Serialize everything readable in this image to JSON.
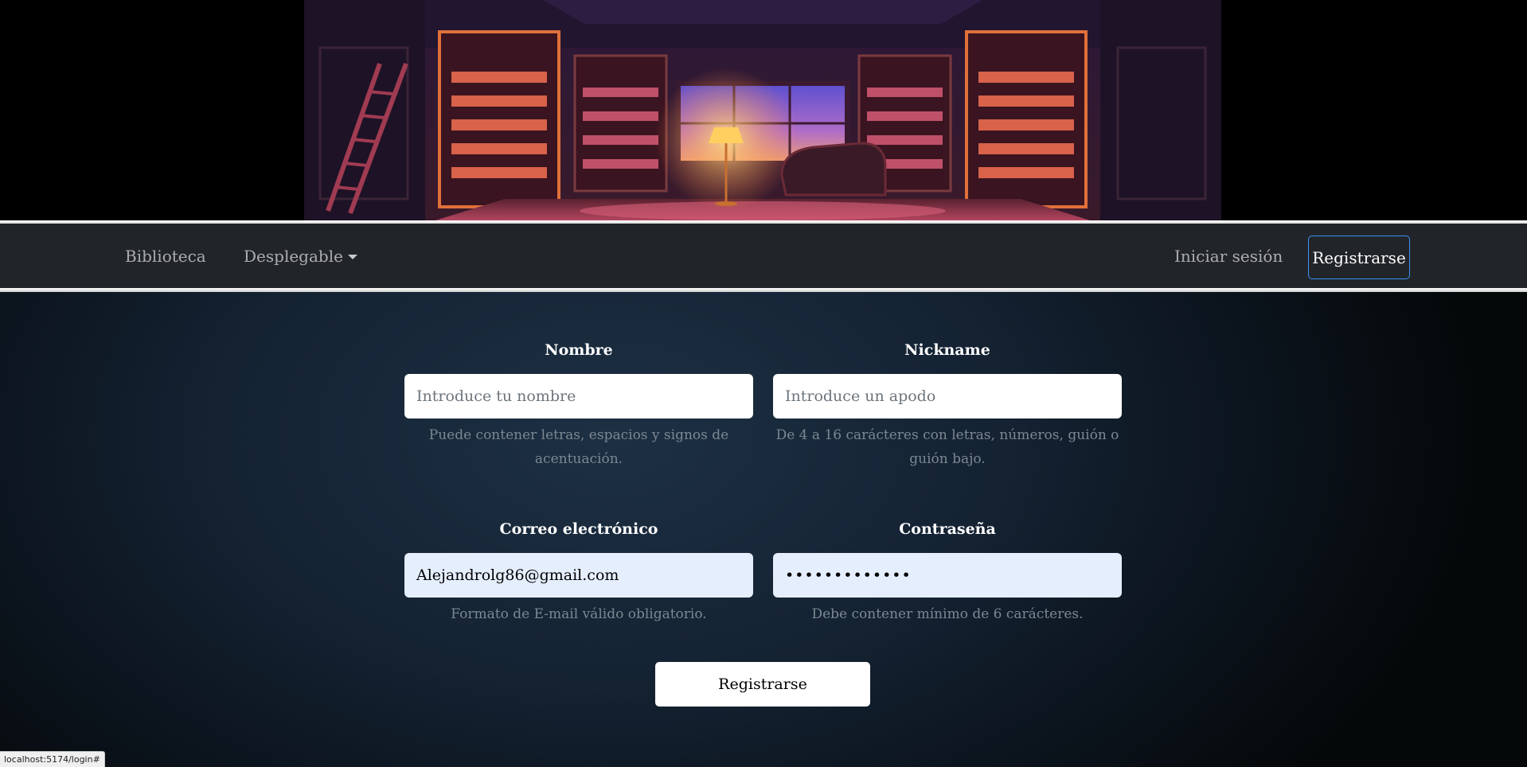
{
  "navbar": {
    "brand": "Biblioteca",
    "dropdown": "Desplegable",
    "login": "Iniciar sesión",
    "register": "Registrarse"
  },
  "form": {
    "nombre": {
      "label": "Nombre",
      "placeholder": "Introduce tu nombre",
      "value": "",
      "help": "Puede contener letras, espacios y signos de acentuación."
    },
    "nickname": {
      "label": "Nickname",
      "placeholder": "Introduce un apodo",
      "value": "",
      "help": "De 4 a 16 carácteres con letras, números, guión o guión bajo."
    },
    "email": {
      "label": "Correo electrónico",
      "value": "Alejandrolg86@gmail.com",
      "help": "Formato de E-mail válido obligatorio."
    },
    "password": {
      "label": "Contraseña",
      "value": "•••••••••••••",
      "help": "Debe contener mínimo de 6 carácteres."
    },
    "submit": "Registrarse"
  },
  "status_bar": {
    "url": "localhost:5174/login#"
  }
}
